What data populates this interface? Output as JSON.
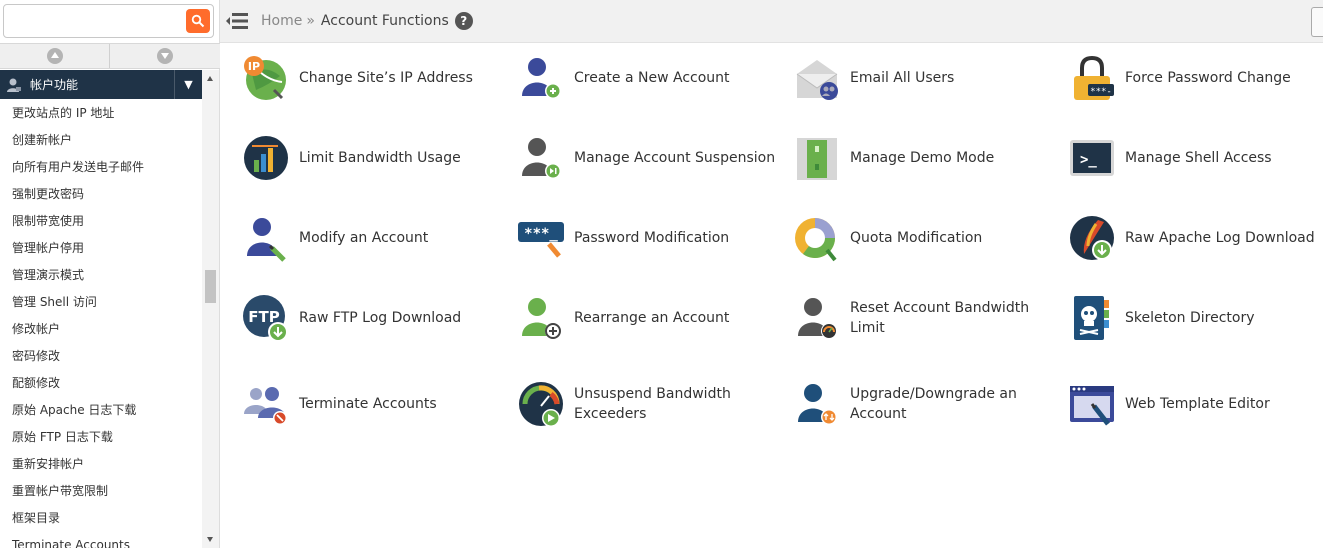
{
  "search": {
    "placeholder": ""
  },
  "sidebar": {
    "group_title": "帐户功能",
    "items": [
      "更改站点的 IP 地址",
      "创建新帐户",
      "向所有用户发送电子邮件",
      "强制更改密码",
      "限制带宽使用",
      "管理帐户停用",
      "管理演示模式",
      "管理 Shell 访问",
      "修改帐户",
      "密码修改",
      "配额修改",
      "原始 Apache 日志下载",
      "原始 FTP 日志下载",
      "重新安排帐户",
      "重置帐户带宽限制",
      "框架目录",
      "Terminate Accounts"
    ]
  },
  "breadcrumb": {
    "home": "Home",
    "separator": "»",
    "current": "Account Functions"
  },
  "functions": [
    {
      "label": "Change Site’s IP Address",
      "icon": "ip-address-icon"
    },
    {
      "label": "Create a New Account",
      "icon": "create-account-icon"
    },
    {
      "label": "Email All Users",
      "icon": "email-users-icon"
    },
    {
      "label": "Force Password Change",
      "icon": "force-password-icon"
    },
    {
      "label": "Limit Bandwidth Usage",
      "icon": "bandwidth-icon"
    },
    {
      "label": "Manage Account Suspension",
      "icon": "suspension-icon"
    },
    {
      "label": "Manage Demo Mode",
      "icon": "demo-mode-icon"
    },
    {
      "label": "Manage Shell Access",
      "icon": "shell-icon"
    },
    {
      "label": "Modify an Account",
      "icon": "modify-account-icon"
    },
    {
      "label": "Password Modification",
      "icon": "password-icon"
    },
    {
      "label": "Quota Modification",
      "icon": "quota-icon"
    },
    {
      "label": "Raw Apache Log Download",
      "icon": "apache-log-icon"
    },
    {
      "label": "Raw FTP Log Download",
      "icon": "ftp-log-icon"
    },
    {
      "label": "Rearrange an Account",
      "icon": "rearrange-icon"
    },
    {
      "label": "Reset Account Bandwidth Limit",
      "icon": "reset-bandwidth-icon"
    },
    {
      "label": "Skeleton Directory",
      "icon": "skeleton-icon"
    },
    {
      "label": "Terminate Accounts",
      "icon": "terminate-icon"
    },
    {
      "label": "Unsuspend Bandwidth Exceeders",
      "icon": "unsuspend-icon"
    },
    {
      "label": "Upgrade/Downgrade an Account",
      "icon": "upgrade-icon"
    },
    {
      "label": "Web Template Editor",
      "icon": "template-editor-icon"
    }
  ],
  "colors": {
    "accent": "#ff6c2c",
    "sidebar_header": "#1f3347",
    "user_blue": "#3b4a9a",
    "user_green": "#6ab04c",
    "user_grey": "#555555"
  }
}
